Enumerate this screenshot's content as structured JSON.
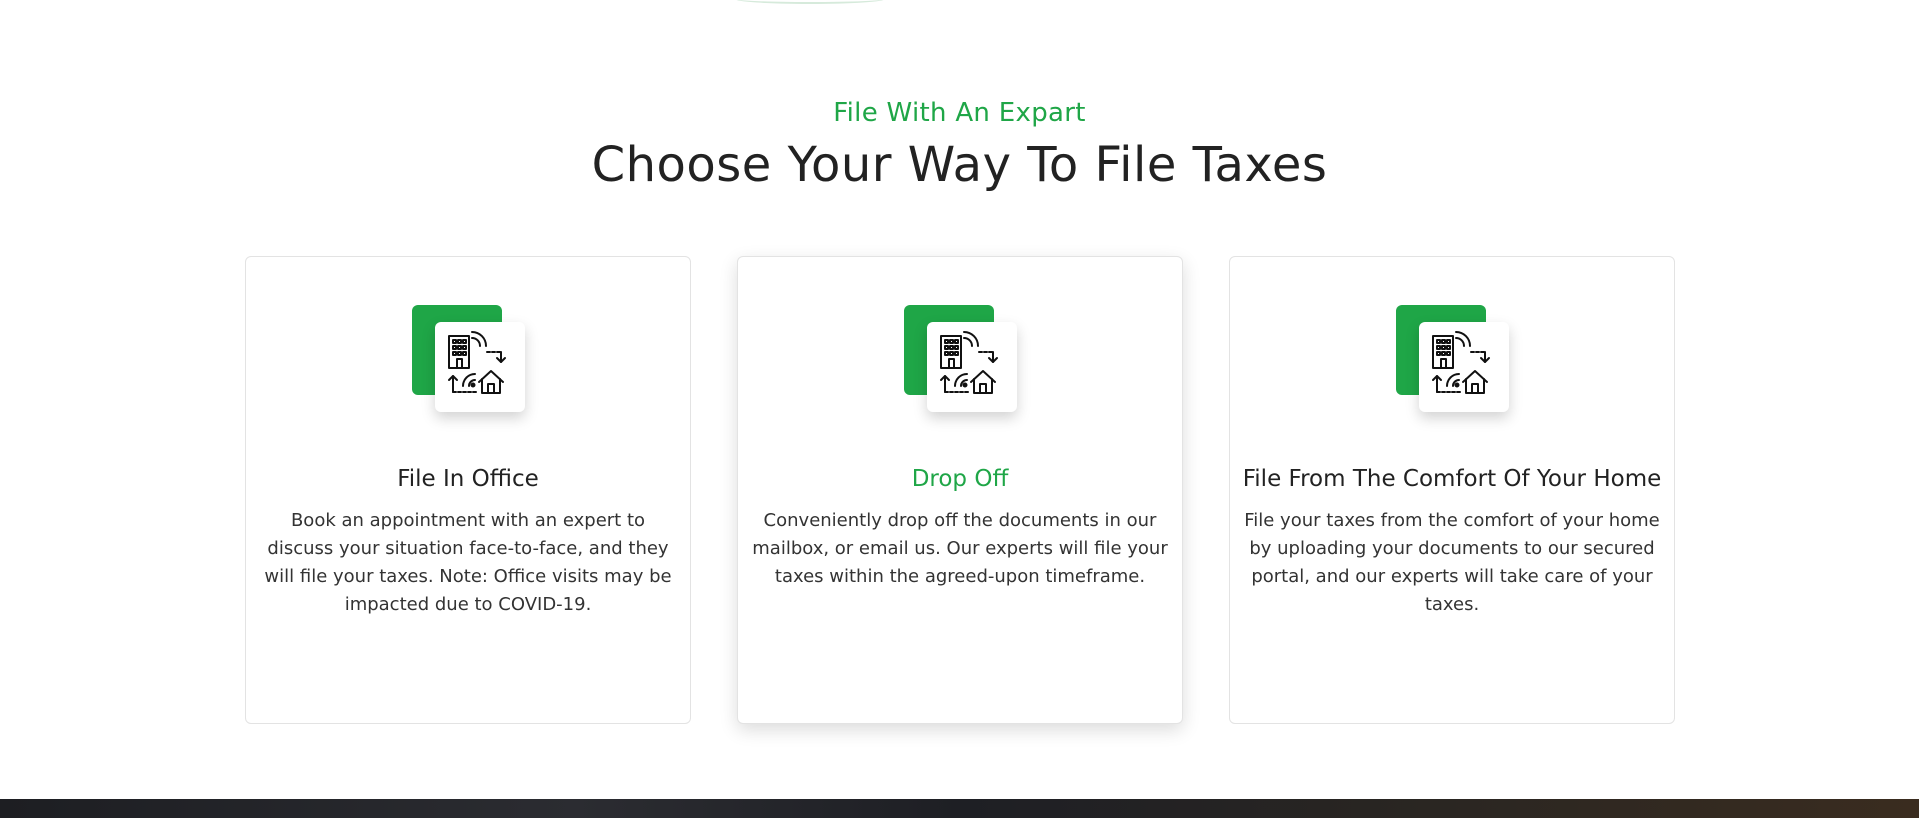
{
  "section": {
    "eyebrow": "File With An Expart",
    "title": "Choose Your Way To File Taxes"
  },
  "cards": [
    {
      "title": "File In Office",
      "text": "Book an appointment with an expert to discuss your situation face-to-face, and they will file your taxes. Note: Office visits may be impacted due to COVID-19.",
      "icon": "office-to-home-icon",
      "active": false
    },
    {
      "title": "Drop Off",
      "text": "Conveniently drop off the documents in our mailbox, or email us. Our experts will file your taxes within the agreed-upon timeframe.",
      "icon": "office-to-home-icon",
      "active": true
    },
    {
      "title": "File From The Comfort Of Your Home",
      "text": "File your taxes from the comfort of your home by uploading your documents to our secured portal, and our experts will take care of your taxes.",
      "icon": "office-to-home-icon",
      "active": false
    }
  ],
  "colors": {
    "accent": "#1fa647",
    "text": "#222222",
    "card_border": "#e3e3e3"
  }
}
